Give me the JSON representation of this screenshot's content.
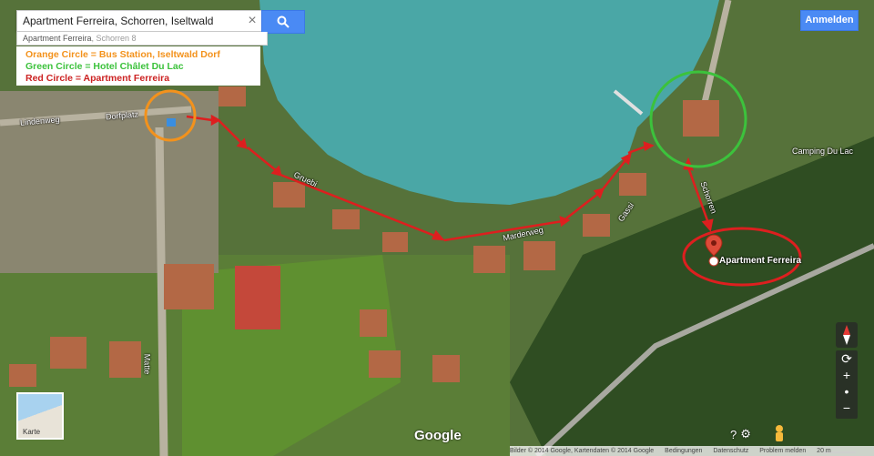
{
  "search": {
    "query": "Apartment Ferreira, Schorren, Iseltwald",
    "suggestion_main": "Apartment Ferreira",
    "suggestion_sub": ", Schorren 8"
  },
  "legend": {
    "orange": "Orange Circle = Bus Station, Iseltwald Dorf",
    "green": "Green Circle = Hotel Châlet Du Lac",
    "red": "Red Circle = Apartment Ferreira"
  },
  "header": {
    "signin_label": "Anmelden"
  },
  "map": {
    "place_label": "Apartment Ferreira",
    "camping_label": "Camping Du Lac",
    "streets": [
      "Dorfplatz",
      "Gruebi",
      "Marderweg",
      "Gassi",
      "Schorren",
      "Matte",
      "Lindenweg"
    ],
    "colors": {
      "orange": "#f3921c",
      "green": "#3cc23c",
      "red": "#dd1f1f",
      "lake": "#4aa7a6"
    }
  },
  "controls": {
    "zoom_in": "+",
    "zoom_out": "−",
    "minimap_label": "Karte",
    "google_logo": "Google"
  },
  "footer": {
    "attribution": "Bilder © 2014 Google, Kartendaten © 2014 Google",
    "terms": "Bedingungen",
    "privacy": "Datenschutz",
    "report": "Problem melden",
    "scale": "20 m"
  }
}
